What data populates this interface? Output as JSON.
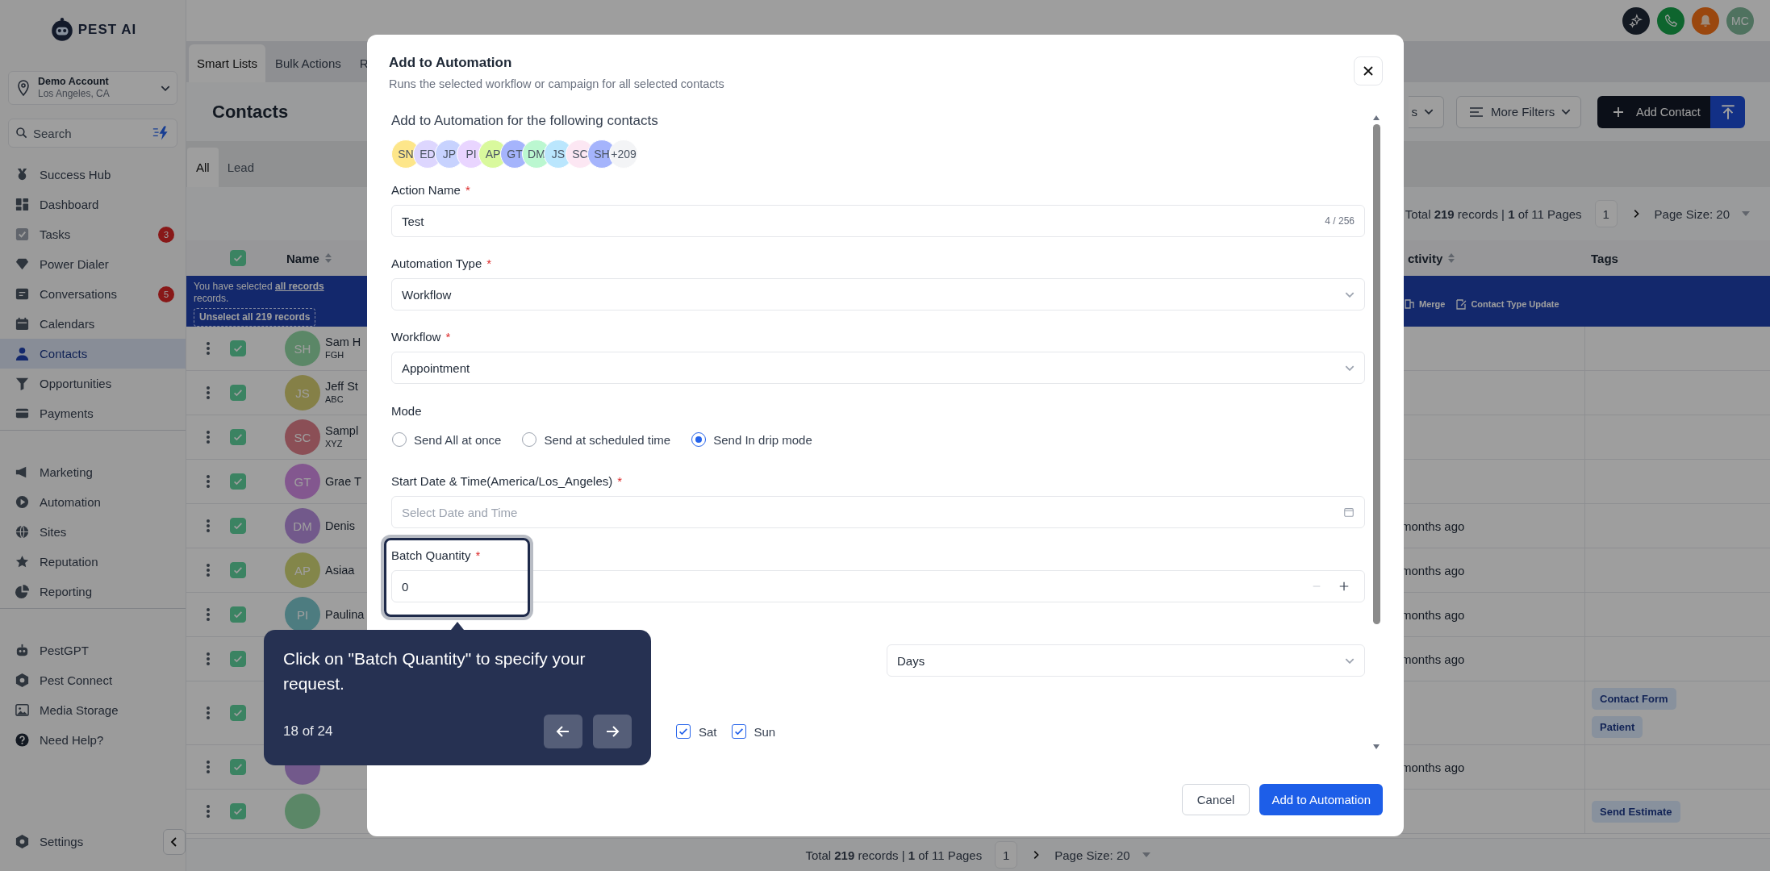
{
  "sidebar": {
    "logo_text": "PEST AI",
    "account": {
      "name": "Demo Account",
      "location": "Los Angeles, CA"
    },
    "search": {
      "placeholder": "Search"
    },
    "groups": [
      {
        "items": [
          {
            "label": "Success Hub",
            "selected": false
          },
          {
            "label": "Dashboard",
            "selected": false
          },
          {
            "label": "Tasks",
            "badge": "3",
            "selected": false
          },
          {
            "label": "Power Dialer",
            "selected": false
          },
          {
            "label": "Conversations",
            "badge": "5",
            "selected": false
          },
          {
            "label": "Calendars",
            "selected": false
          },
          {
            "label": "Contacts",
            "selected": true
          },
          {
            "label": "Opportunities",
            "selected": false
          },
          {
            "label": "Payments",
            "selected": false
          }
        ]
      },
      {
        "items": [
          {
            "label": "Marketing",
            "selected": false
          },
          {
            "label": "Automation",
            "selected": false
          },
          {
            "label": "Sites",
            "selected": false
          },
          {
            "label": "Reputation",
            "selected": false
          },
          {
            "label": "Reporting",
            "selected": false
          }
        ]
      },
      {
        "items": [
          {
            "label": "PestGPT",
            "selected": false
          },
          {
            "label": "Pest Connect",
            "selected": false
          },
          {
            "label": "Media Storage",
            "selected": false
          },
          {
            "label": "Need Help?",
            "selected": false
          }
        ]
      }
    ],
    "settings": "Settings"
  },
  "header": {
    "avatar": "MC"
  },
  "tabs": [
    {
      "label": "Smart Lists",
      "selected": true
    },
    {
      "label": "Bulk Actions",
      "selected": false
    },
    {
      "label": "R",
      "selected": false
    }
  ],
  "page": {
    "title": "Contacts",
    "filter_button": "s",
    "more_filters": "More Filters",
    "add_contact": "Add Contact"
  },
  "list_tabs": [
    {
      "label": "All",
      "selected": true
    },
    {
      "label": "Lead",
      "selected": false
    }
  ],
  "pagination_top": {
    "summary": "Total **219** records | **1** of 11 Pages",
    "page": "1",
    "page_size": "Page Size: 20"
  },
  "table": {
    "all_checked": true,
    "columns": [
      "Name",
      "ctivity",
      "Tags"
    ],
    "banner": {
      "before": "You have selected",
      "link": "all records",
      "after": "records.",
      "unselect": "Unselect all 219 records",
      "actions": [
        "Merge",
        "Contact Type Update"
      ]
    },
    "rows": [
      {
        "initials": "SH",
        "color": "#5b8767",
        "name": "Sam H",
        "company": "FGH",
        "checked": true
      },
      {
        "initials": "JS",
        "color": "#858047",
        "name": "Jeff St",
        "company": "ABC",
        "checked": true
      },
      {
        "initials": "SC",
        "color": "#8b4f56",
        "name": "Sampl",
        "company": "XYZ",
        "checked": true
      },
      {
        "initials": "GT",
        "color": "#83578f",
        "name": "Grae T",
        "checked": true
      },
      {
        "initials": "DM",
        "color": "#72598b",
        "name": "Denis",
        "checked": true,
        "activity": "months ago"
      },
      {
        "initials": "AP",
        "color": "#83864a",
        "name": "Asiaa",
        "checked": true,
        "activity": "months ago"
      },
      {
        "initials": "PI",
        "color": "#4d7c80",
        "name": "Paulina",
        "checked": true,
        "activity": "months ago"
      },
      {
        "checked": true,
        "activity": "months ago"
      },
      {
        "checked": true,
        "tags": [
          "Contact Form",
          "Patient"
        ]
      },
      {
        "color": "#72598b",
        "checked": true,
        "activity": "months ago"
      },
      {
        "color": "#5b8767",
        "checked": true,
        "tags": [
          "Send Estimate"
        ]
      }
    ]
  },
  "pagination_bottom": {
    "summary": "Total **219** records | **1** of 11 Pages",
    "page": "1",
    "page_size": "Page Size: 20"
  },
  "modal": {
    "title": "Add to Automation",
    "subtitle": "Runs the selected workflow or campaign for all selected contacts",
    "contacts_heading": "Add to Automation for the following contacts",
    "contacts": [
      {
        "initials": "SN",
        "color": "#fde68a"
      },
      {
        "initials": "ED",
        "color": "#ddd6fe"
      },
      {
        "initials": "JP",
        "color": "#c7d2fe"
      },
      {
        "initials": "PI",
        "color": "#e9d5ff"
      },
      {
        "initials": "AP",
        "color": "#d9f99d"
      },
      {
        "initials": "GT",
        "color": "#a5b4fc"
      },
      {
        "initials": "DM",
        "color": "#bbf7d0"
      },
      {
        "initials": "JS",
        "color": "#bae6fd"
      },
      {
        "initials": "SC",
        "color": "#fce7f3"
      },
      {
        "initials": "SH",
        "color": "#a5b4fc"
      }
    ],
    "more_contacts": "+209",
    "action_name": {
      "label": "Action Name",
      "required": "*",
      "value": "Test",
      "counter": "4 / 256"
    },
    "automation_type": {
      "label": "Automation Type",
      "required": "*",
      "value": "Workflow"
    },
    "workflow": {
      "label": "Workflow",
      "required": "*",
      "value": "Appointment"
    },
    "mode": {
      "label": "Mode",
      "options": [
        {
          "label": "Send All at once",
          "selected": false
        },
        {
          "label": "Send at scheduled time",
          "selected": false
        },
        {
          "label": "Send In drip mode",
          "selected": true
        }
      ]
    },
    "start": {
      "label": "Start Date & Time(America/Los_Angeles)",
      "required": "*",
      "placeholder": "Select Date and Time"
    },
    "batch": {
      "label": "Batch Quantity",
      "required": "*",
      "value": "0"
    },
    "repeat_unit": {
      "value": "Days"
    },
    "days": [
      {
        "label": "Sat",
        "checked": true
      },
      {
        "label": "Sun",
        "checked": true
      }
    ],
    "cancel": "Cancel",
    "submit": "Add to Automation"
  },
  "tour": {
    "text": "Click on \"Batch Quantity\" to specify your request.",
    "step": "18 of 24"
  }
}
